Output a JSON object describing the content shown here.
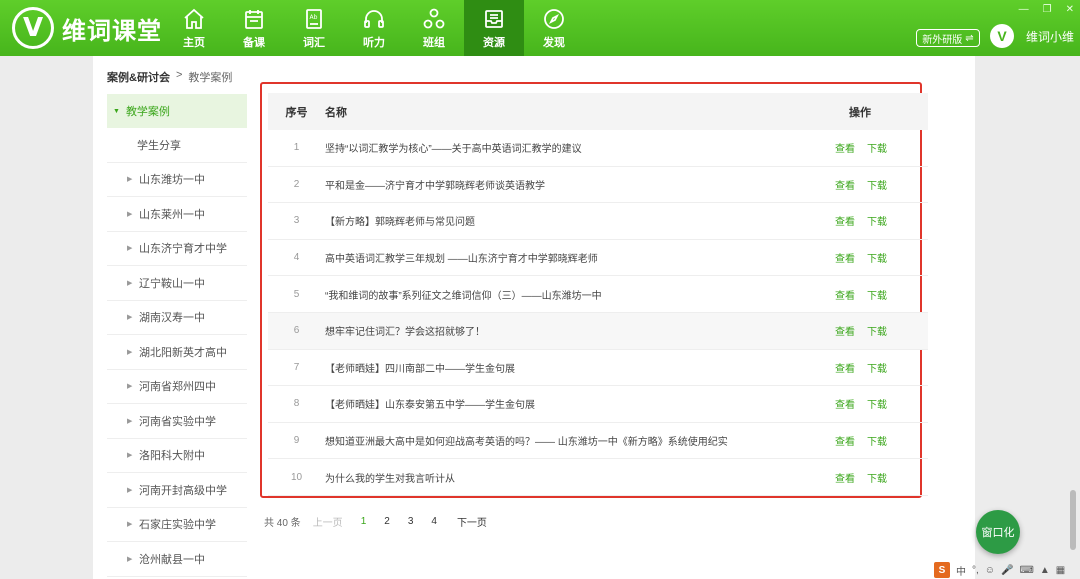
{
  "app": {
    "logo_letter": "V",
    "name": "维词课堂"
  },
  "nav": [
    {
      "label": "主页",
      "icon": "home-icon"
    },
    {
      "label": "备课",
      "icon": "calendar-icon"
    },
    {
      "label": "词汇",
      "icon": "vocab-book-icon"
    },
    {
      "label": "听力",
      "icon": "headphones-icon"
    },
    {
      "label": "班组",
      "icon": "group-icon"
    },
    {
      "label": "资源",
      "icon": "resource-inbox-icon",
      "active": true
    },
    {
      "label": "发现",
      "icon": "compass-icon"
    }
  ],
  "edition": {
    "label": "新外研版",
    "swap_glyph": "⇌"
  },
  "user": {
    "avatar_letter": "V",
    "name": "维词小维"
  },
  "window_controls": {
    "minimize": "—",
    "restore": "❐",
    "close": "✕"
  },
  "breadcrumb": {
    "root": "案例&研讨会",
    "separator": ">",
    "current": "教学案例"
  },
  "sidebar": {
    "head": {
      "arrow": "▼",
      "label": "教学案例"
    },
    "sub": "学生分享",
    "items": [
      "山东潍坊一中",
      "山东莱州一中",
      "山东济宁育才中学",
      "辽宁鞍山一中",
      "湖南汉寿一中",
      "湖北阳新英才高中",
      "河南省郑州四中",
      "河南省实验中学",
      "洛阳科大附中",
      "河南开封高级中学",
      "石家庄实验中学",
      "沧州献县一中"
    ]
  },
  "table": {
    "headers": {
      "no": "序号",
      "name": "名称",
      "op": "操作"
    },
    "view_label": "查看",
    "download_label": "下载",
    "rows": [
      {
        "no": "1",
        "name": "坚持“以词汇教学为核心”——关于高中英语词汇教学的建议"
      },
      {
        "no": "2",
        "name": "平和是金——济宁育才中学郭晓辉老师谈英语教学"
      },
      {
        "no": "3",
        "name": "【新方略】郭晓辉老师与常见问题"
      },
      {
        "no": "4",
        "name": "高中英语词汇教学三年规划 ——山东济宁育才中学郭晓辉老师"
      },
      {
        "no": "5",
        "name": "“我和维词的故事”系列征文之维词信仰（三）——山东潍坊一中"
      },
      {
        "no": "6",
        "name": "想牢牢记住词汇？学会这招就够了！"
      },
      {
        "no": "7",
        "name": "【老师晒娃】四川南部二中——学生金句展"
      },
      {
        "no": "8",
        "name": "【老师晒娃】山东泰安第五中学——学生金句展"
      },
      {
        "no": "9",
        "name": "想知道亚洲最大高中是如何迎战高考英语的吗？—— 山东潍坊一中《新方略》系统使用纪实"
      },
      {
        "no": "10",
        "name": "为什么我的学生对我言听计从"
      }
    ]
  },
  "pager": {
    "total": "共 40 条",
    "prev": "上一页",
    "pages": [
      "1",
      "2",
      "3",
      "4"
    ],
    "next": "下一页",
    "current": "1"
  },
  "fab": {
    "label": "窗口化"
  },
  "tray": {
    "ime": "S",
    "lang": "中",
    "punct": "°,"
  },
  "colors": {
    "brand": "#47b51c",
    "nav_active": "#2f8d13",
    "link": "#3aa61a",
    "highlight_frame": "#e0352b"
  }
}
